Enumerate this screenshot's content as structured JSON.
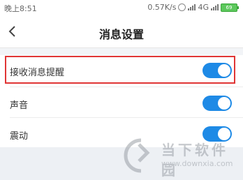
{
  "status_bar": {
    "time": "晚上8:51",
    "network_speed": "0.57K/s",
    "network_type": "4G",
    "battery": "69"
  },
  "header": {
    "title": "消息设置",
    "back_icon": "chevron-left-icon"
  },
  "settings": [
    {
      "label": "接收消息提醒",
      "enabled": true,
      "highlighted": true
    },
    {
      "label": "声音",
      "enabled": true,
      "highlighted": false
    },
    {
      "label": "震动",
      "enabled": true,
      "highlighted": false
    }
  ],
  "watermark": {
    "text": "当下软件园",
    "url": "www.downxia.com"
  },
  "colors": {
    "toggle_on": "#1e8ae6",
    "highlight_border": "#e03535",
    "page_background": "#edf0f4"
  }
}
